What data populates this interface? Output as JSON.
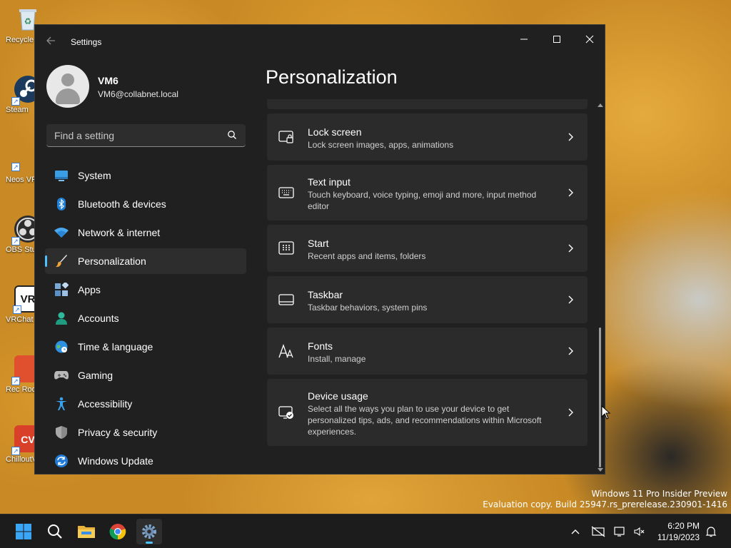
{
  "desktop": {
    "icons": [
      {
        "label": "Recycle Bin",
        "name": "recycle-bin"
      },
      {
        "label": "Steam",
        "name": "steam"
      },
      {
        "label": "Neos VR",
        "name": "neos"
      },
      {
        "label": "OBS Studio",
        "name": "obs"
      },
      {
        "label": "VRChat",
        "name": "vrchat"
      },
      {
        "label": "Rec Room",
        "name": "rec-room"
      },
      {
        "label": "ChilloutVR",
        "name": "chilloutvr"
      }
    ],
    "watermark": {
      "line1": "Windows 11 Pro Insider Preview",
      "line2": "Evaluation copy. Build 25947.rs_prerelease.230901-1416"
    }
  },
  "window": {
    "title": "Settings",
    "controls": {
      "minimize": "—",
      "maximize": "☐",
      "close": "✕"
    }
  },
  "profile": {
    "name": "VM6",
    "email": "VM6@collabnet.local"
  },
  "search": {
    "placeholder": "Find a setting"
  },
  "nav": {
    "items": [
      {
        "label": "System",
        "icon": "monitor-icon"
      },
      {
        "label": "Bluetooth & devices",
        "icon": "bluetooth-icon"
      },
      {
        "label": "Network & internet",
        "icon": "wifi-icon"
      },
      {
        "label": "Personalization",
        "icon": "brush-icon",
        "active": true
      },
      {
        "label": "Apps",
        "icon": "apps-icon"
      },
      {
        "label": "Accounts",
        "icon": "accounts-icon"
      },
      {
        "label": "Time & language",
        "icon": "globe-clock-icon"
      },
      {
        "label": "Gaming",
        "icon": "gamepad-icon"
      },
      {
        "label": "Accessibility",
        "icon": "accessibility-icon"
      },
      {
        "label": "Privacy & security",
        "icon": "shield-icon"
      },
      {
        "label": "Windows Update",
        "icon": "update-icon"
      }
    ]
  },
  "main": {
    "title": "Personalization",
    "cards": [
      {
        "title": "Lock screen",
        "desc": "Lock screen images, apps, animations",
        "icon": "lock-screen-icon"
      },
      {
        "title": "Text input",
        "desc": "Touch keyboard, voice typing, emoji and more, input method editor",
        "icon": "keyboard-icon"
      },
      {
        "title": "Start",
        "desc": "Recent apps and items, folders",
        "icon": "start-icon"
      },
      {
        "title": "Taskbar",
        "desc": "Taskbar behaviors, system pins",
        "icon": "taskbar-icon"
      },
      {
        "title": "Fonts",
        "desc": "Install, manage",
        "icon": "fonts-icon"
      },
      {
        "title": "Device usage",
        "desc": "Select all the ways you plan to use your device to get personalized tips, ads, and recommendations within Microsoft experiences.",
        "icon": "device-usage-icon"
      }
    ]
  },
  "taskbar": {
    "time": "6:20 PM",
    "date": "11/19/2023"
  },
  "colors": {
    "accent": "#4cc2ff",
    "window_bg": "#202020",
    "card_bg": "#2b2b2b"
  }
}
